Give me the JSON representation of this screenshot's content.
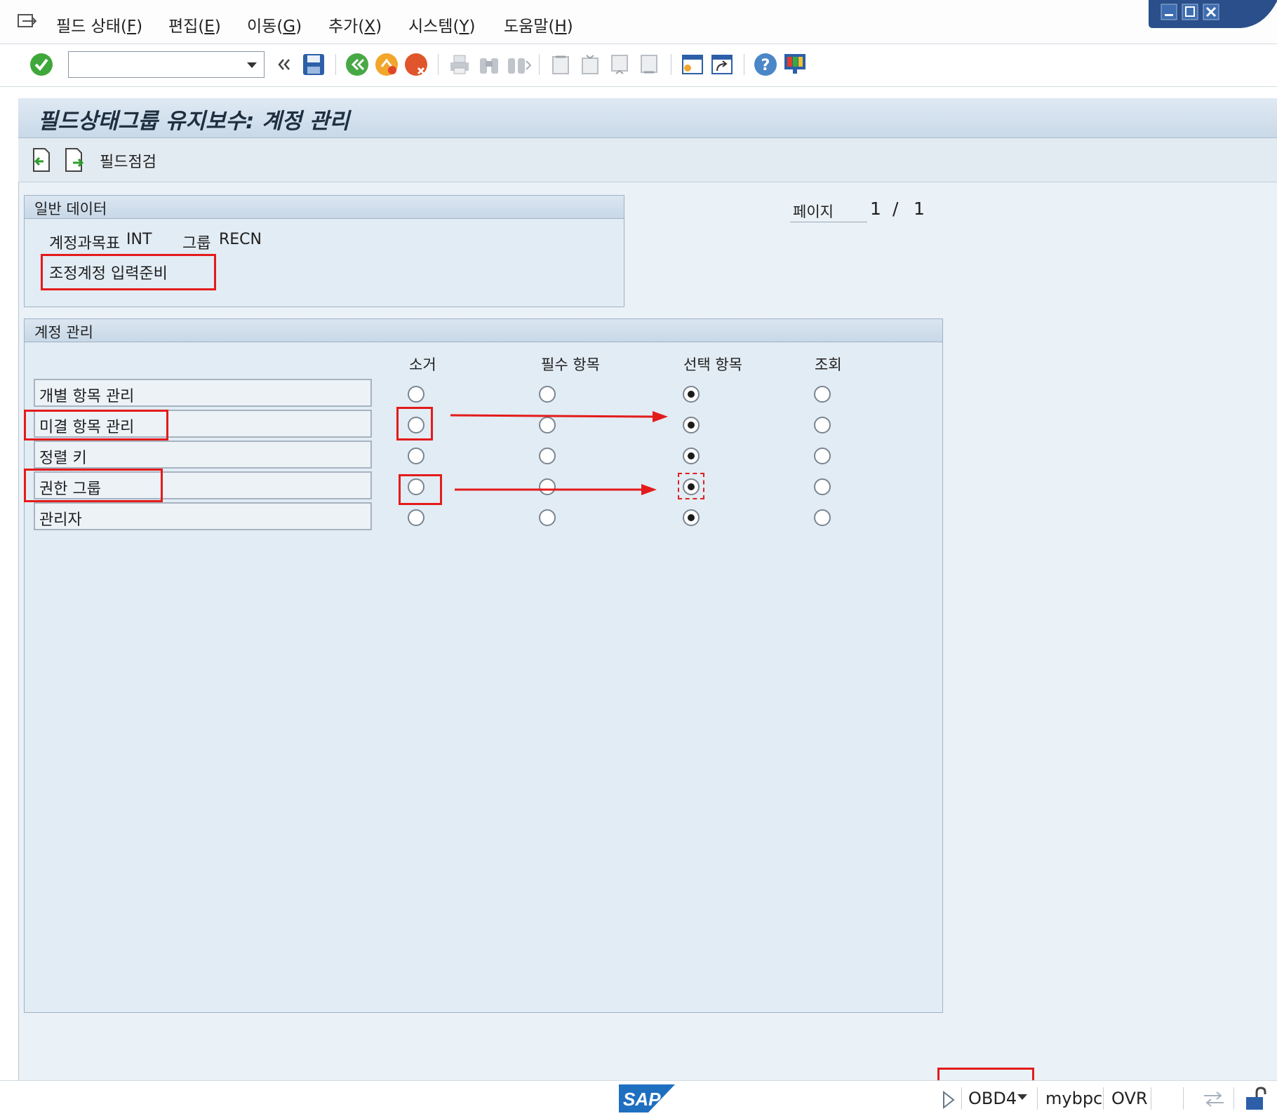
{
  "menu": {
    "items": [
      {
        "label": "필드 상태(",
        "key": "F",
        "end": ")"
      },
      {
        "label": "편집(",
        "key": "E",
        "end": ")"
      },
      {
        "label": "이동(",
        "key": "G",
        "end": ")"
      },
      {
        "label": "추가(",
        "key": "X",
        "end": ")"
      },
      {
        "label": "시스템(",
        "key": "Y",
        "end": ")"
      },
      {
        "label": "도움말(",
        "key": "H",
        "end": ")"
      }
    ]
  },
  "toolbar": {
    "command_value": "",
    "icons": [
      "enter-icon",
      "back-icon",
      "exit-icon",
      "cancel-icon",
      "print-icon",
      "find-icon",
      "find-next-icon",
      "first-page-icon",
      "previous-page-icon",
      "next-page-icon",
      "last-page-icon",
      "create-session-icon",
      "shortcut-icon",
      "help-icon",
      "layout-icon"
    ]
  },
  "title": "필드상태그룹 유지보수: 계정 관리",
  "appbar": {
    "field_check_label": "필드점검"
  },
  "general": {
    "title": "일반 데이터",
    "coa_label": "계정과목표",
    "coa_value": "INT",
    "group_label": "그룹",
    "group_value": "RECN",
    "group_desc": "조정계정 입력준비"
  },
  "paging": {
    "label": "페이지",
    "current": "1",
    "separator": "/",
    "total": "1"
  },
  "account": {
    "title": "계정 관리",
    "columns": [
      "소거",
      "필수 항목",
      "선택 항목",
      "조회"
    ],
    "rows": [
      {
        "label": "개별 항목 관리",
        "selected": 2
      },
      {
        "label": "미결 항목 관리",
        "selected": 2
      },
      {
        "label": "정렬 키",
        "selected": 2
      },
      {
        "label": "권한 그룹",
        "selected": 2
      },
      {
        "label": "관리자",
        "selected": 2
      }
    ]
  },
  "status": {
    "transaction": "OBD4",
    "server": "mybpc",
    "mode": "OVR",
    "logo": "SAP"
  },
  "colors": {
    "annotation": "#e41b1b",
    "sap_blue": "#1f6fc0"
  }
}
